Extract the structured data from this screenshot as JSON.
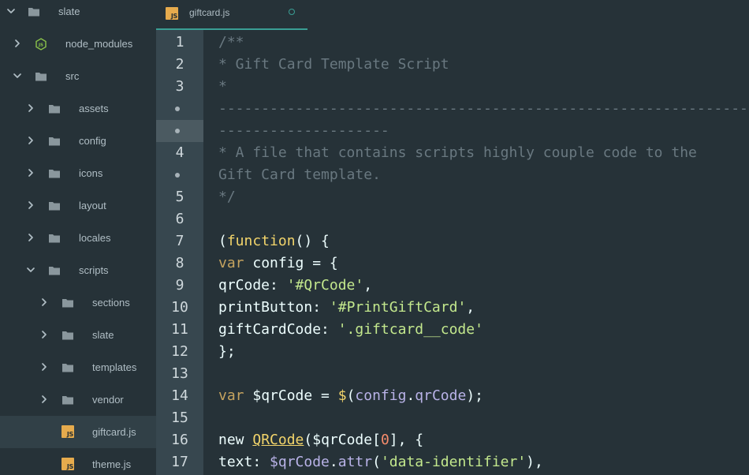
{
  "sidebar": {
    "items": [
      {
        "label": "slate",
        "type": "folder",
        "expanded": true,
        "depth": 0
      },
      {
        "label": "node_modules",
        "type": "node-folder",
        "expanded": false,
        "depth": 1
      },
      {
        "label": "src",
        "type": "folder",
        "expanded": true,
        "depth": 1
      },
      {
        "label": "assets",
        "type": "folder",
        "expanded": false,
        "depth": 2
      },
      {
        "label": "config",
        "type": "folder",
        "expanded": false,
        "depth": 2
      },
      {
        "label": "icons",
        "type": "folder",
        "expanded": false,
        "depth": 2
      },
      {
        "label": "layout",
        "type": "folder",
        "expanded": false,
        "depth": 2
      },
      {
        "label": "locales",
        "type": "folder",
        "expanded": false,
        "depth": 2
      },
      {
        "label": "scripts",
        "type": "folder",
        "expanded": true,
        "depth": 2
      },
      {
        "label": "sections",
        "type": "folder",
        "expanded": false,
        "depth": 3
      },
      {
        "label": "slate",
        "type": "folder",
        "expanded": false,
        "depth": 3
      },
      {
        "label": "templates",
        "type": "folder",
        "expanded": false,
        "depth": 3
      },
      {
        "label": "vendor",
        "type": "folder",
        "expanded": false,
        "depth": 3
      },
      {
        "label": "giftcard.js",
        "type": "js-file",
        "selected": true,
        "depth": 3
      },
      {
        "label": "theme.js",
        "type": "js-file",
        "depth": 3
      }
    ]
  },
  "tabs": [
    {
      "label": "giftcard.js",
      "badge": "JS",
      "modified": true,
      "active": true
    }
  ],
  "editor": {
    "gutter": [
      "1",
      "2",
      "3",
      "•",
      "•",
      "4",
      "•",
      "5",
      "6",
      "7",
      "8",
      "9",
      "10",
      "11",
      "12",
      "13",
      "14",
      "15",
      "16",
      "17"
    ],
    "current_row": 4,
    "lines": [
      [
        {
          "t": "/**",
          "c": "comment"
        }
      ],
      [
        {
          "t": "* Gift Card Template Script",
          "c": "comment"
        }
      ],
      [
        {
          "t": "*",
          "c": "comment"
        }
      ],
      [
        {
          "t": "--------------------------------------------------------------",
          "c": "comment"
        }
      ],
      [
        {
          "t": "--------------------",
          "c": "comment"
        }
      ],
      [
        {
          "t": "* A file that contains scripts highly couple code to the",
          "c": "comment"
        }
      ],
      [
        {
          "t": "Gift Card template.",
          "c": "comment"
        }
      ],
      [
        {
          "t": "*/",
          "c": "comment"
        }
      ],
      [],
      [
        {
          "t": "(",
          "c": "plain"
        },
        {
          "t": "function",
          "c": "fn"
        },
        {
          "t": "() {",
          "c": "plain"
        }
      ],
      [
        {
          "t": "var",
          "c": "kw"
        },
        {
          "t": " config = {",
          "c": "plain"
        }
      ],
      [
        {
          "t": "qrCode: ",
          "c": "plain"
        },
        {
          "t": "'#QrCode'",
          "c": "str"
        },
        {
          "t": ",",
          "c": "plain"
        }
      ],
      [
        {
          "t": "printButton: ",
          "c": "plain"
        },
        {
          "t": "'#PrintGiftCard'",
          "c": "str"
        },
        {
          "t": ",",
          "c": "plain"
        }
      ],
      [
        {
          "t": "giftCardCode: ",
          "c": "plain"
        },
        {
          "t": "'.giftcard__code'",
          "c": "str"
        }
      ],
      [
        {
          "t": "};",
          "c": "plain"
        }
      ],
      [],
      [
        {
          "t": "var",
          "c": "kw"
        },
        {
          "t": " $qrCode = ",
          "c": "plain"
        },
        {
          "t": "$",
          "c": "fn"
        },
        {
          "t": "(",
          "c": "plain"
        },
        {
          "t": "config",
          "c": "prop"
        },
        {
          "t": ".",
          "c": "plain"
        },
        {
          "t": "qrCode",
          "c": "prop"
        },
        {
          "t": ");",
          "c": "plain"
        }
      ],
      [],
      [
        {
          "t": "new ",
          "c": "plain"
        },
        {
          "t": "QRCode",
          "c": "cls"
        },
        {
          "t": "($qrCode[",
          "c": "plain"
        },
        {
          "t": "0",
          "c": "num"
        },
        {
          "t": "], {",
          "c": "plain"
        }
      ],
      [
        {
          "t": "text: ",
          "c": "plain"
        },
        {
          "t": "$qrCode",
          "c": "prop"
        },
        {
          "t": ".",
          "c": "plain"
        },
        {
          "t": "attr",
          "c": "prop"
        },
        {
          "t": "(",
          "c": "plain"
        },
        {
          "t": "'data-identifier'",
          "c": "str"
        },
        {
          "t": "),",
          "c": "plain"
        }
      ]
    ]
  },
  "colors": {
    "accent": "#3a9e94",
    "js_badge": "#e6ab4d",
    "node_icon": "#8bc34a"
  }
}
